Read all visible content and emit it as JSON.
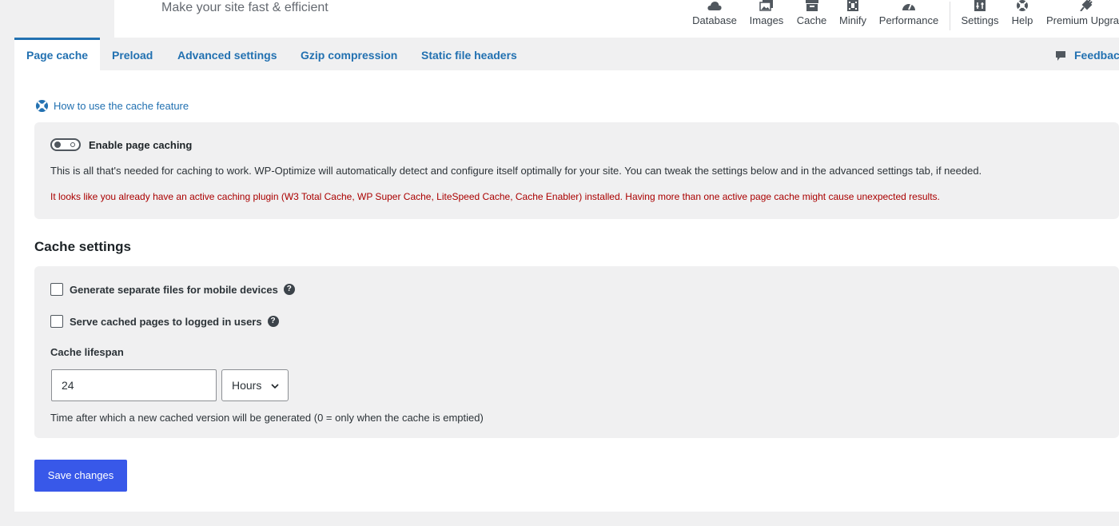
{
  "header": {
    "tagline": "Make your site fast & efficient",
    "nav": [
      {
        "label": "Database",
        "icon": "cloud-icon"
      },
      {
        "label": "Images",
        "icon": "images-icon"
      },
      {
        "label": "Cache",
        "icon": "archive-icon",
        "active": true
      },
      {
        "label": "Minify",
        "icon": "film-icon"
      },
      {
        "label": "Performance",
        "icon": "dashboard-icon"
      },
      {
        "label": "Settings",
        "icon": "settings-icon"
      },
      {
        "label": "Help",
        "icon": "lifebuoy-icon"
      },
      {
        "label": "Premium Upgra",
        "icon": "plug-icon"
      }
    ],
    "active_color": "#e07a35"
  },
  "tabs": {
    "items": [
      "Page cache",
      "Preload",
      "Advanced settings",
      "Gzip compression",
      "Static file headers"
    ],
    "active_index": 0,
    "feedback_label": "Feedbac"
  },
  "howto": {
    "label": "How to use the cache feature"
  },
  "enable": {
    "toggle_on": false,
    "label": "Enable page caching",
    "description": "This is all that's needed for caching to work. WP-Optimize will automatically detect and configure itself optimally for your site. You can tweak the settings below and in the advanced settings tab, if needed.",
    "warning": "It looks like you already have an active caching plugin (W3 Total Cache, WP Super Cache, LiteSpeed Cache, Cache Enabler) installed. Having more than one active page cache might cause unexpected results."
  },
  "cache_settings": {
    "title": "Cache settings",
    "mobile_label": "Generate separate files for mobile devices",
    "mobile_checked": false,
    "logged_in_label": "Serve cached pages to logged in users",
    "logged_in_checked": false,
    "help_glyph": "?",
    "lifespan_label": "Cache lifespan",
    "lifespan_value": "24",
    "lifespan_unit": "Hours",
    "lifespan_hint": "Time after which a new cached version will be generated (0 = only when the cache is emptied)"
  },
  "save_button": "Save changes",
  "colors": {
    "link": "#2271b1",
    "primary_button": "#3858e9",
    "warning": "#aa0000"
  }
}
